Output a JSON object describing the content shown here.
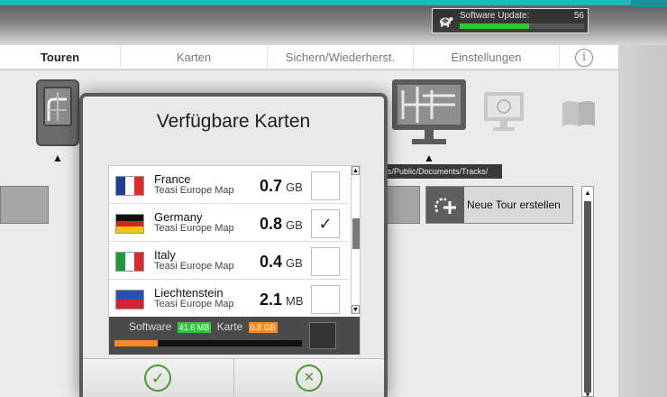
{
  "update": {
    "label": "Software Update:",
    "percent_label": "56",
    "progress": 0.56,
    "icon": "turtle-icon"
  },
  "tabs": [
    {
      "label": "Touren",
      "active": true
    },
    {
      "label": "Karten",
      "active": false
    },
    {
      "label": "Sichern/Wiederherst.",
      "active": false
    },
    {
      "label": "Einstellungen",
      "active": false
    }
  ],
  "info_icon": "info-icon",
  "background": {
    "path_label": "s/Public/Documents/Tracks/",
    "new_tour_label": "Neue Tour erstellen",
    "arrow": "▲"
  },
  "dialog": {
    "title": "Verfügbare Karten",
    "maps": [
      {
        "name": "France",
        "subtitle": "Teasi Europe Map",
        "size": "0.7",
        "unit": "GB",
        "checked": false,
        "check": "",
        "flag": "france"
      },
      {
        "name": "Germany",
        "subtitle": "Teasi Europe Map",
        "size": "0.8",
        "unit": "GB",
        "checked": true,
        "check": "✓",
        "flag": "germany"
      },
      {
        "name": "Italy",
        "subtitle": "Teasi Europe Map",
        "size": "0.4",
        "unit": "GB",
        "checked": false,
        "check": "",
        "flag": "italy"
      },
      {
        "name": "Liechtenstein",
        "subtitle": "Teasi Europe Map",
        "size": "2.1",
        "unit": "MB",
        "checked": false,
        "check": "",
        "flag": "liechtenstein"
      }
    ],
    "usage": {
      "software_label": "Software",
      "software_size": "41.6 MB",
      "map_label": "Karte",
      "map_size": "0.8 GB",
      "progress": 0.23
    },
    "confirm_symbol": "✓",
    "cancel_symbol": "✕"
  },
  "colors": {
    "accent_teal": "#2bb3be",
    "update_green": "#35c53a",
    "usage_orange": "#ff8a1f",
    "button_green": "#4c9a2a"
  }
}
